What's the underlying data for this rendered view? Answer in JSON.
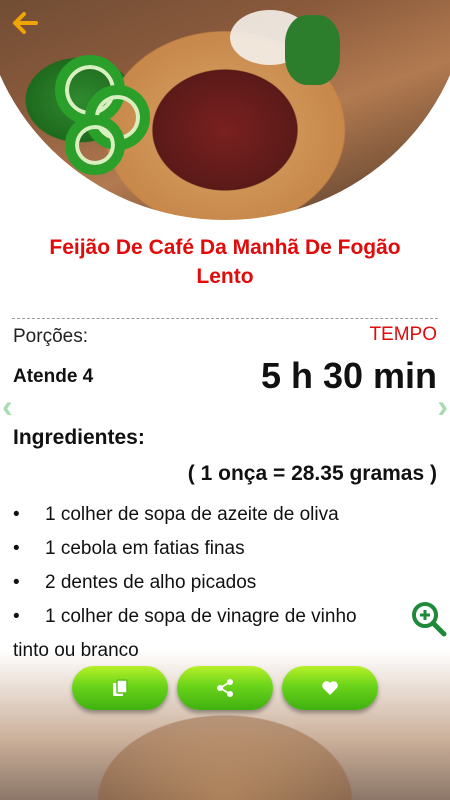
{
  "recipe": {
    "title": "Feijão De Café Da Manhã De Fogão Lento"
  },
  "info": {
    "servings_label": "Porções:",
    "time_label": "TEMPO",
    "servings_value": "Atende 4",
    "time_value": "5 h 30 min"
  },
  "ingredients": {
    "title": "Ingredientes:",
    "conversion": "( 1 onça = 28.35 gramas )",
    "items": [
      "1 colher de sopa de azeite de oliva",
      "1 cebola em fatias finas",
      "2 dentes de alho picados",
      "1 colher de sopa de vinagre de vinho",
      "tinto ou branco"
    ]
  },
  "icons": {
    "back": "arrow-left-icon",
    "prev": "chevron-left-icon",
    "next": "chevron-right-icon",
    "zoom": "zoom-in-icon",
    "copy": "copy-icon",
    "share": "share-icon",
    "favorite": "heart-icon"
  },
  "colors": {
    "title": "#e20b0b",
    "accent": "#f2a400",
    "button": "#6bd41a",
    "zoom": "#1f8a3a"
  }
}
